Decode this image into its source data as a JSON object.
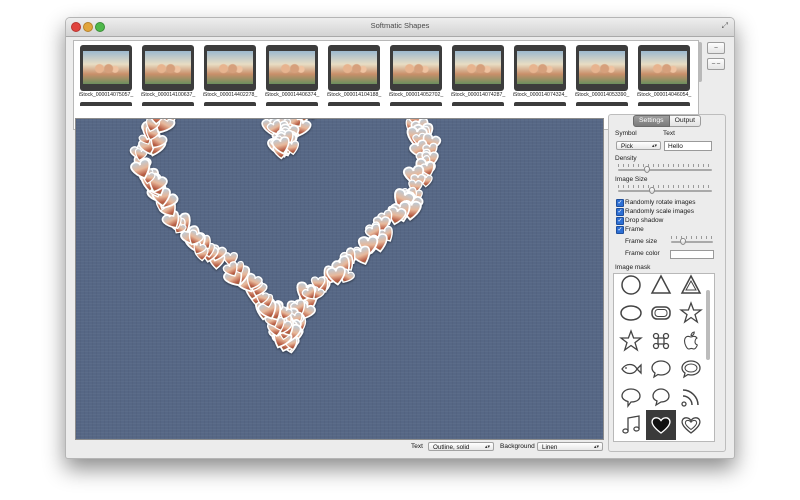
{
  "window": {
    "title": "Softmatic Shapes"
  },
  "thumbnails": [
    {
      "label": "iStock_000014075057_"
    },
    {
      "label": "iStock_000014100637_"
    },
    {
      "label": "iStock_000014402278_"
    },
    {
      "label": "iStock_000014406374_"
    },
    {
      "label": "iStock_000014104188_"
    },
    {
      "label": "iStock_000014052702_"
    },
    {
      "label": "iStock_000014074287_"
    },
    {
      "label": "iStock_000014074324_"
    },
    {
      "label": "iStock_000014053390_"
    },
    {
      "label": "iStock_000014046054_"
    }
  ],
  "strip_buttons": {
    "minus": "–",
    "double_minus": "– –"
  },
  "tabs": {
    "settings": "Settings",
    "output": "Output"
  },
  "settings": {
    "symbol_label": "Symbol",
    "symbol_value": "Pick",
    "text_label": "Text",
    "text_value": "Hello",
    "density_label": "Density",
    "density_level": 0.3,
    "image_size_label": "Image Size",
    "image_size_level": 0.35,
    "checkboxes": [
      {
        "label": "Randomly rotate images",
        "checked": true
      },
      {
        "label": "Randomly scale images",
        "checked": true
      },
      {
        "label": "Drop shadow",
        "checked": true
      },
      {
        "label": "Frame",
        "checked": true
      }
    ],
    "frame_size_label": "Frame size",
    "frame_size_level": 0.25,
    "frame_color_label": "Frame color",
    "frame_color": "#ffffff",
    "image_mask_label": "Image mask"
  },
  "masks": [
    "circle-outline-icon",
    "triangle-icon",
    "triangle-outline-icon",
    "ellipse-icon",
    "rounded-rect-icon",
    "star-icon",
    "star-outline-icon",
    "cmd-key-icon",
    "apple-icon",
    "fish-icon",
    "speech-bubble-icon",
    "speech-bubble-outline-icon",
    "chat-bubble-icon",
    "thought-bubble-icon",
    "rss-icon",
    "music-note-icon",
    "heart-icon",
    "heart-outline-icon"
  ],
  "selected_mask": "heart-icon",
  "bottom_bar": {
    "text_label": "Text",
    "text_value": "Outline, solid",
    "background_label": "Background",
    "background_value": "Linen"
  },
  "colors": {
    "canvas": "#566785",
    "accent": "#2d6fd4"
  }
}
